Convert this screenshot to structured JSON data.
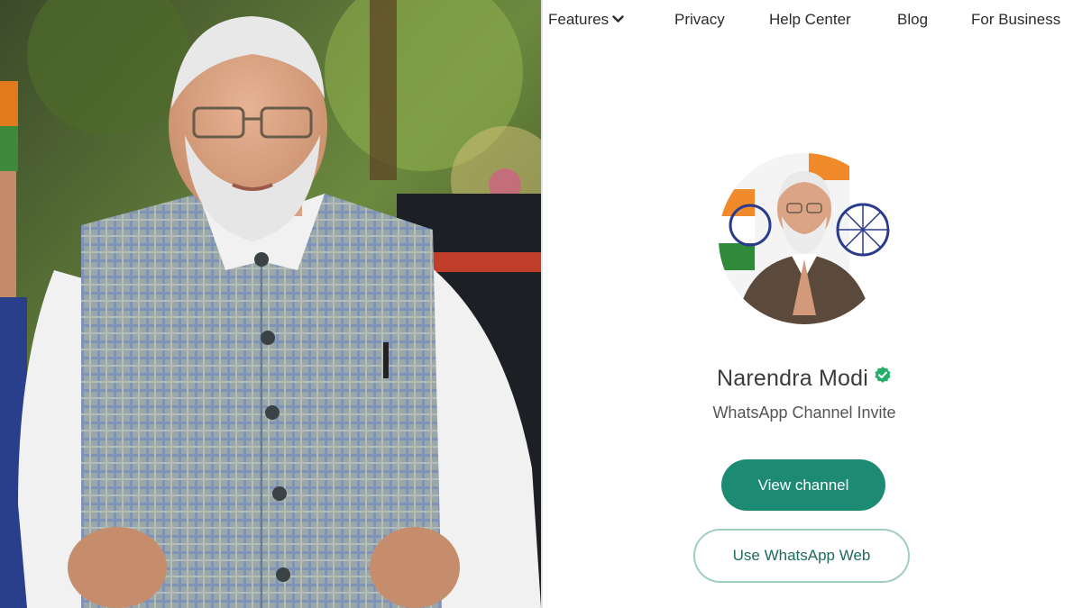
{
  "nav": {
    "features_label": "Features",
    "privacy_label": "Privacy",
    "help_label": "Help Center",
    "blog_label": "Blog",
    "business_label": "For Business"
  },
  "channel": {
    "name": "Narendra Modi",
    "verified": true,
    "subtitle": "WhatsApp Channel Invite"
  },
  "actions": {
    "view_channel_label": "View channel",
    "web_label": "Use WhatsApp Web"
  },
  "colors": {
    "accent": "#1d8a74",
    "verified_badge": "#25b06a",
    "outline_border": "#9fcfc4"
  },
  "icons": {
    "features_dropdown": "chevron-down-icon",
    "verified": "verified-badge-icon"
  }
}
